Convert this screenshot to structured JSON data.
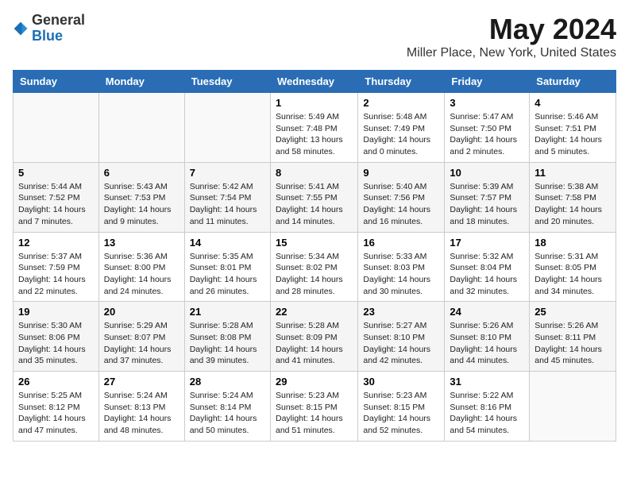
{
  "header": {
    "logo_general": "General",
    "logo_blue": "Blue",
    "title": "May 2024",
    "subtitle": "Miller Place, New York, United States"
  },
  "weekdays": [
    "Sunday",
    "Monday",
    "Tuesday",
    "Wednesday",
    "Thursday",
    "Friday",
    "Saturday"
  ],
  "weeks": [
    [
      {
        "day": "",
        "info": ""
      },
      {
        "day": "",
        "info": ""
      },
      {
        "day": "",
        "info": ""
      },
      {
        "day": "1",
        "info": "Sunrise: 5:49 AM\nSunset: 7:48 PM\nDaylight: 13 hours and 58 minutes."
      },
      {
        "day": "2",
        "info": "Sunrise: 5:48 AM\nSunset: 7:49 PM\nDaylight: 14 hours and 0 minutes."
      },
      {
        "day": "3",
        "info": "Sunrise: 5:47 AM\nSunset: 7:50 PM\nDaylight: 14 hours and 2 minutes."
      },
      {
        "day": "4",
        "info": "Sunrise: 5:46 AM\nSunset: 7:51 PM\nDaylight: 14 hours and 5 minutes."
      }
    ],
    [
      {
        "day": "5",
        "info": "Sunrise: 5:44 AM\nSunset: 7:52 PM\nDaylight: 14 hours and 7 minutes."
      },
      {
        "day": "6",
        "info": "Sunrise: 5:43 AM\nSunset: 7:53 PM\nDaylight: 14 hours and 9 minutes."
      },
      {
        "day": "7",
        "info": "Sunrise: 5:42 AM\nSunset: 7:54 PM\nDaylight: 14 hours and 11 minutes."
      },
      {
        "day": "8",
        "info": "Sunrise: 5:41 AM\nSunset: 7:55 PM\nDaylight: 14 hours and 14 minutes."
      },
      {
        "day": "9",
        "info": "Sunrise: 5:40 AM\nSunset: 7:56 PM\nDaylight: 14 hours and 16 minutes."
      },
      {
        "day": "10",
        "info": "Sunrise: 5:39 AM\nSunset: 7:57 PM\nDaylight: 14 hours and 18 minutes."
      },
      {
        "day": "11",
        "info": "Sunrise: 5:38 AM\nSunset: 7:58 PM\nDaylight: 14 hours and 20 minutes."
      }
    ],
    [
      {
        "day": "12",
        "info": "Sunrise: 5:37 AM\nSunset: 7:59 PM\nDaylight: 14 hours and 22 minutes."
      },
      {
        "day": "13",
        "info": "Sunrise: 5:36 AM\nSunset: 8:00 PM\nDaylight: 14 hours and 24 minutes."
      },
      {
        "day": "14",
        "info": "Sunrise: 5:35 AM\nSunset: 8:01 PM\nDaylight: 14 hours and 26 minutes."
      },
      {
        "day": "15",
        "info": "Sunrise: 5:34 AM\nSunset: 8:02 PM\nDaylight: 14 hours and 28 minutes."
      },
      {
        "day": "16",
        "info": "Sunrise: 5:33 AM\nSunset: 8:03 PM\nDaylight: 14 hours and 30 minutes."
      },
      {
        "day": "17",
        "info": "Sunrise: 5:32 AM\nSunset: 8:04 PM\nDaylight: 14 hours and 32 minutes."
      },
      {
        "day": "18",
        "info": "Sunrise: 5:31 AM\nSunset: 8:05 PM\nDaylight: 14 hours and 34 minutes."
      }
    ],
    [
      {
        "day": "19",
        "info": "Sunrise: 5:30 AM\nSunset: 8:06 PM\nDaylight: 14 hours and 35 minutes."
      },
      {
        "day": "20",
        "info": "Sunrise: 5:29 AM\nSunset: 8:07 PM\nDaylight: 14 hours and 37 minutes."
      },
      {
        "day": "21",
        "info": "Sunrise: 5:28 AM\nSunset: 8:08 PM\nDaylight: 14 hours and 39 minutes."
      },
      {
        "day": "22",
        "info": "Sunrise: 5:28 AM\nSunset: 8:09 PM\nDaylight: 14 hours and 41 minutes."
      },
      {
        "day": "23",
        "info": "Sunrise: 5:27 AM\nSunset: 8:10 PM\nDaylight: 14 hours and 42 minutes."
      },
      {
        "day": "24",
        "info": "Sunrise: 5:26 AM\nSunset: 8:10 PM\nDaylight: 14 hours and 44 minutes."
      },
      {
        "day": "25",
        "info": "Sunrise: 5:26 AM\nSunset: 8:11 PM\nDaylight: 14 hours and 45 minutes."
      }
    ],
    [
      {
        "day": "26",
        "info": "Sunrise: 5:25 AM\nSunset: 8:12 PM\nDaylight: 14 hours and 47 minutes."
      },
      {
        "day": "27",
        "info": "Sunrise: 5:24 AM\nSunset: 8:13 PM\nDaylight: 14 hours and 48 minutes."
      },
      {
        "day": "28",
        "info": "Sunrise: 5:24 AM\nSunset: 8:14 PM\nDaylight: 14 hours and 50 minutes."
      },
      {
        "day": "29",
        "info": "Sunrise: 5:23 AM\nSunset: 8:15 PM\nDaylight: 14 hours and 51 minutes."
      },
      {
        "day": "30",
        "info": "Sunrise: 5:23 AM\nSunset: 8:15 PM\nDaylight: 14 hours and 52 minutes."
      },
      {
        "day": "31",
        "info": "Sunrise: 5:22 AM\nSunset: 8:16 PM\nDaylight: 14 hours and 54 minutes."
      },
      {
        "day": "",
        "info": ""
      }
    ]
  ]
}
